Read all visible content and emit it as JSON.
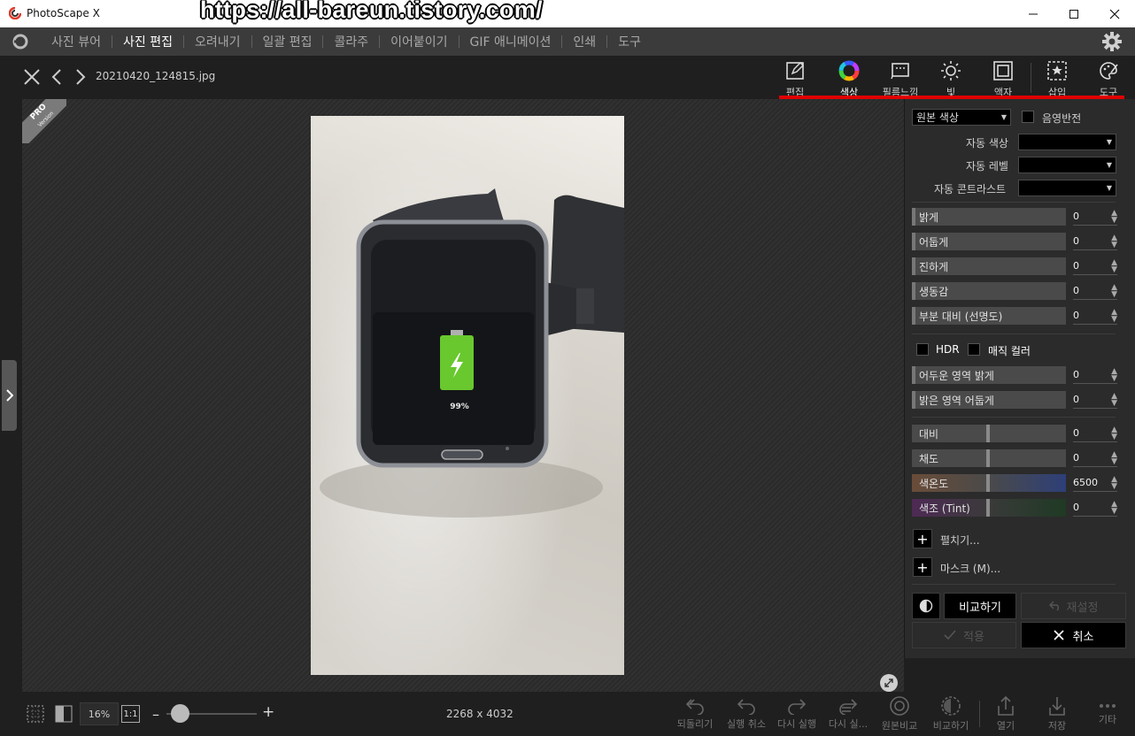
{
  "window": {
    "title": "PhotoScape X",
    "minimize": "–",
    "maximize": "☐",
    "close": "✕"
  },
  "overlay": {
    "url": "https://all-bareun.tistory.com/"
  },
  "menu": {
    "items": [
      "사진 뷰어",
      "사진 편집",
      "오려내기",
      "일괄 편집",
      "콜라주",
      "이어붙이기",
      "GIF 애니메이션",
      "인쇄",
      "도구"
    ],
    "active": "사진 편집"
  },
  "toolbar": {
    "filename": "20210420_124815.jpg",
    "tabs": [
      {
        "label": "편집",
        "icon": "edit-icon"
      },
      {
        "label": "색상",
        "icon": "color-wheel-icon"
      },
      {
        "label": "필름느낌",
        "icon": "film-icon"
      },
      {
        "label": "빛",
        "icon": "light-icon"
      },
      {
        "label": "액자",
        "icon": "frame-icon"
      },
      {
        "label": "삽입",
        "icon": "insert-icon"
      },
      {
        "label": "도구",
        "icon": "palette-icon"
      }
    ],
    "active_tab": "색상",
    "accent": "#e00000"
  },
  "photo": {
    "battery": "99%",
    "badge_line1": "PRO",
    "badge_line2": "Version"
  },
  "panel": {
    "color_mode": "원본 색상",
    "invert_label": "음영반전",
    "auto_color": "자동 색상",
    "auto_level": "자동 레벨",
    "auto_contrast": "자동 콘트라스트",
    "sliders1": [
      {
        "label": "밝게",
        "value": "0"
      },
      {
        "label": "어둡게",
        "value": "0"
      },
      {
        "label": "진하게",
        "value": "0"
      },
      {
        "label": "생동감",
        "value": "0"
      },
      {
        "label": "부분 대비 (선명도)",
        "value": "0"
      }
    ],
    "hdr_label": "HDR",
    "magic_label": "매직 컬러",
    "sliders2": [
      {
        "label": "어두운 영역 밝게",
        "value": "0"
      },
      {
        "label": "밝은 영역 어둡게",
        "value": "0"
      }
    ],
    "sliders3": [
      {
        "label": "대비",
        "value": "0"
      },
      {
        "label": "채도",
        "value": "0"
      },
      {
        "label": "색온도",
        "value": "6500"
      },
      {
        "label": "색조 (Tint)",
        "value": "0"
      }
    ],
    "expand_label": "펼치기...",
    "mask_label": "마스크 (M)...",
    "compare_label": "비교하기",
    "reset_label": "재설정",
    "apply_label": "적용",
    "cancel_label": "취소"
  },
  "bottom": {
    "zoom": "16%",
    "one_to_one": "1:1",
    "zoom_level": 0.15,
    "dimensions": "2268 x 4032",
    "actions": [
      "되돌리기",
      "실행 취소",
      "다시 실행",
      "다시 실...",
      "원본비교",
      "비교하기",
      "열기",
      "저장",
      "기타"
    ]
  }
}
